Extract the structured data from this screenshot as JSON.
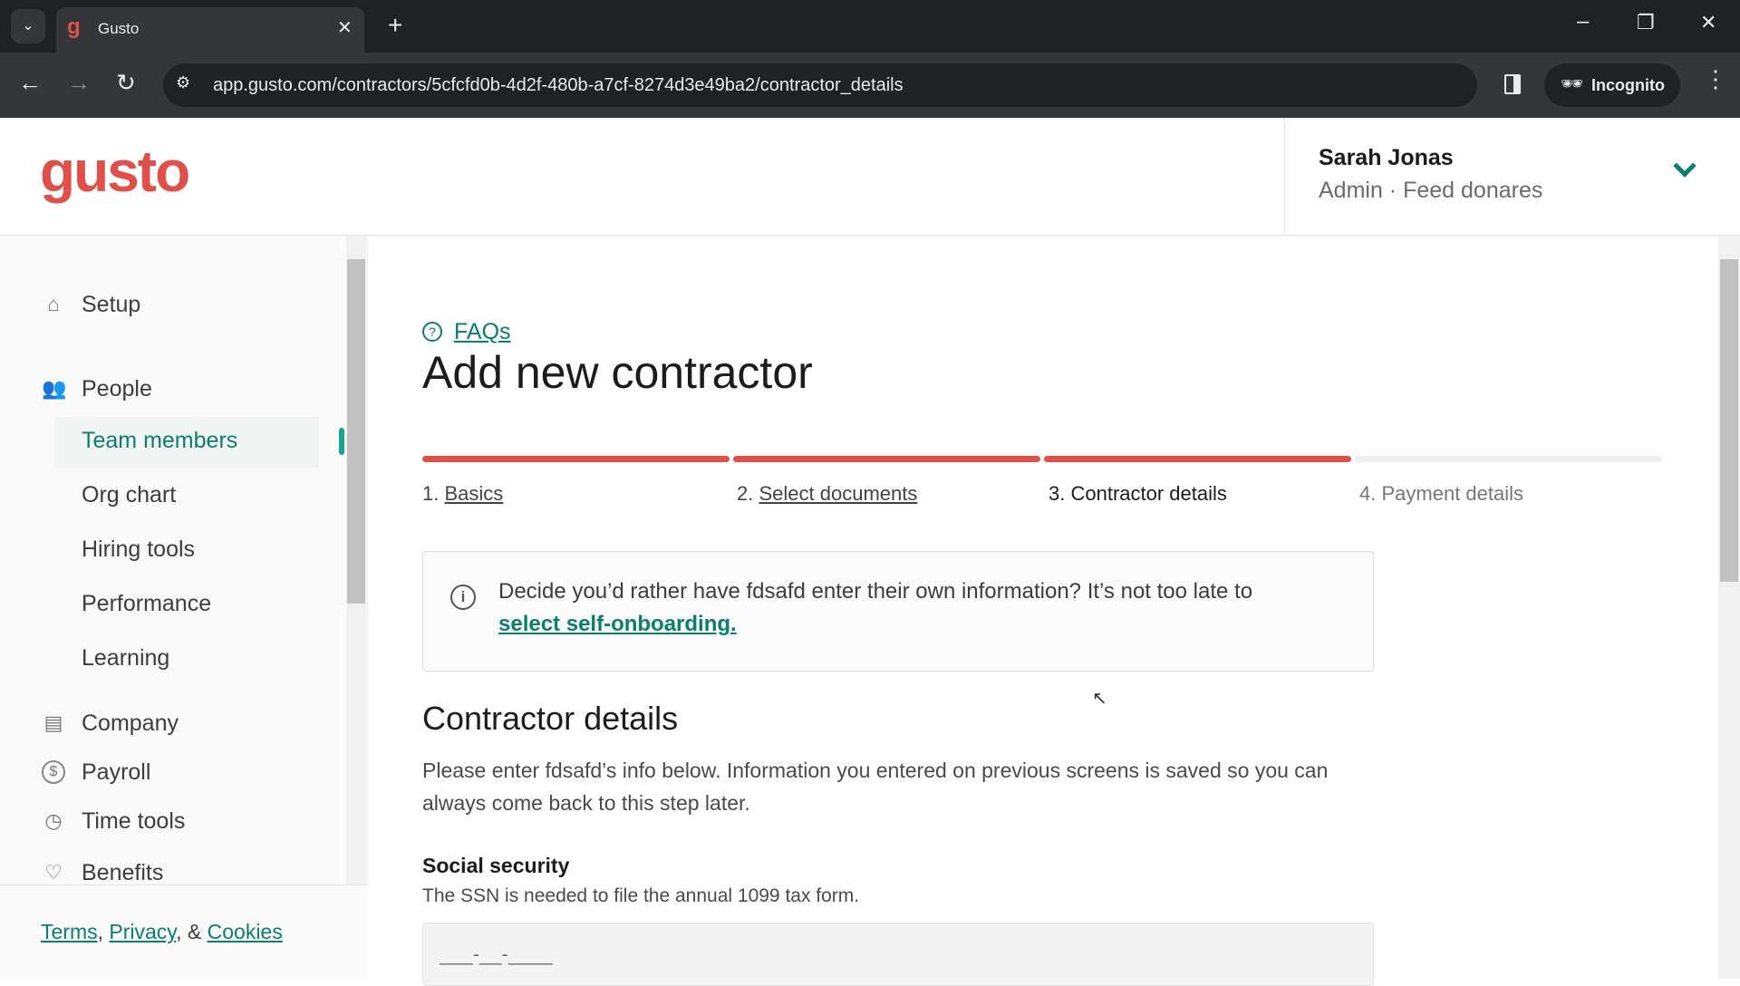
{
  "browser": {
    "tab_title": "Gusto",
    "url": "app.gusto.com/contractors/5cfcfd0b-4d2f-480b-a7cf-8274d3e49ba2/contractor_details",
    "incognito_label": "Incognito"
  },
  "header": {
    "logo": "gusto",
    "user_name": "Sarah Jonas",
    "user_role": "Admin · Feed donares"
  },
  "sidebar": {
    "items": [
      {
        "label": "Setup",
        "icon": "home-icon"
      },
      {
        "label": "People",
        "icon": "people-icon"
      },
      {
        "label": "Team members",
        "active": true
      },
      {
        "label": "Org chart"
      },
      {
        "label": "Hiring tools"
      },
      {
        "label": "Performance"
      },
      {
        "label": "Learning"
      },
      {
        "label": "Company",
        "icon": "store-icon"
      },
      {
        "label": "Payroll",
        "icon": "dollar-icon"
      },
      {
        "label": "Time tools",
        "icon": "clock-icon"
      },
      {
        "label": "Benefits",
        "icon": "heart-icon"
      }
    ],
    "footer": {
      "terms": "Terms",
      "sep1": ",",
      "privacy": "Privacy",
      "sep2": ", &",
      "cookies": "Cookies"
    }
  },
  "main": {
    "faqs": "FAQs",
    "title": "Add new contractor",
    "progress": {
      "completed_steps": 3,
      "total_steps": 4
    },
    "steps": [
      {
        "num": "1.",
        "label": "Basics"
      },
      {
        "num": "2.",
        "label": "Select documents"
      },
      {
        "num": "3.",
        "label": "Contractor details"
      },
      {
        "num": "4.",
        "label": "Payment details"
      }
    ],
    "info": {
      "text": "Decide you’d rather have fdsafd enter their own information? It’s not too late to",
      "link": "select self-onboarding."
    },
    "section_title": "Contractor details",
    "section_desc": "Please enter fdsafd’s info below. Information you entered on previous screens is saved so you can always come back to this step later.",
    "ssn": {
      "label": "Social security",
      "help": "The SSN is needed to file the annual 1099 tax form.",
      "placeholder": "___-__-____"
    }
  },
  "colors": {
    "brand": "#e0504a",
    "accent": "#0a7f6e"
  }
}
